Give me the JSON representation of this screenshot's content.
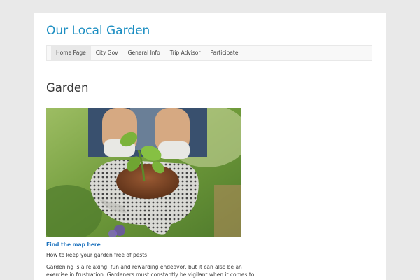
{
  "site": {
    "title": "Our Local Garden"
  },
  "nav": {
    "items": [
      {
        "label": "Home Page",
        "active": true
      },
      {
        "label": "City Gov"
      },
      {
        "label": "General Info"
      },
      {
        "label": "Trip Advisor"
      },
      {
        "label": "Participate"
      }
    ]
  },
  "main": {
    "page_title": "Garden",
    "hero_image": "gloved-hands-holding-seedling",
    "map_link": "Find the map here",
    "subheading": "How to keep your garden free of pests",
    "paragraph": "Gardening is a relaxing, fun and rewarding endeavor, but it can also be an exercise in frustration. Gardeners must constantly be vigilant when it comes to pests, lest their"
  },
  "colors": {
    "link": "#1e73be",
    "title": "#1a8dc1",
    "text": "#3a3a3a",
    "background": "#e9e9e9"
  }
}
